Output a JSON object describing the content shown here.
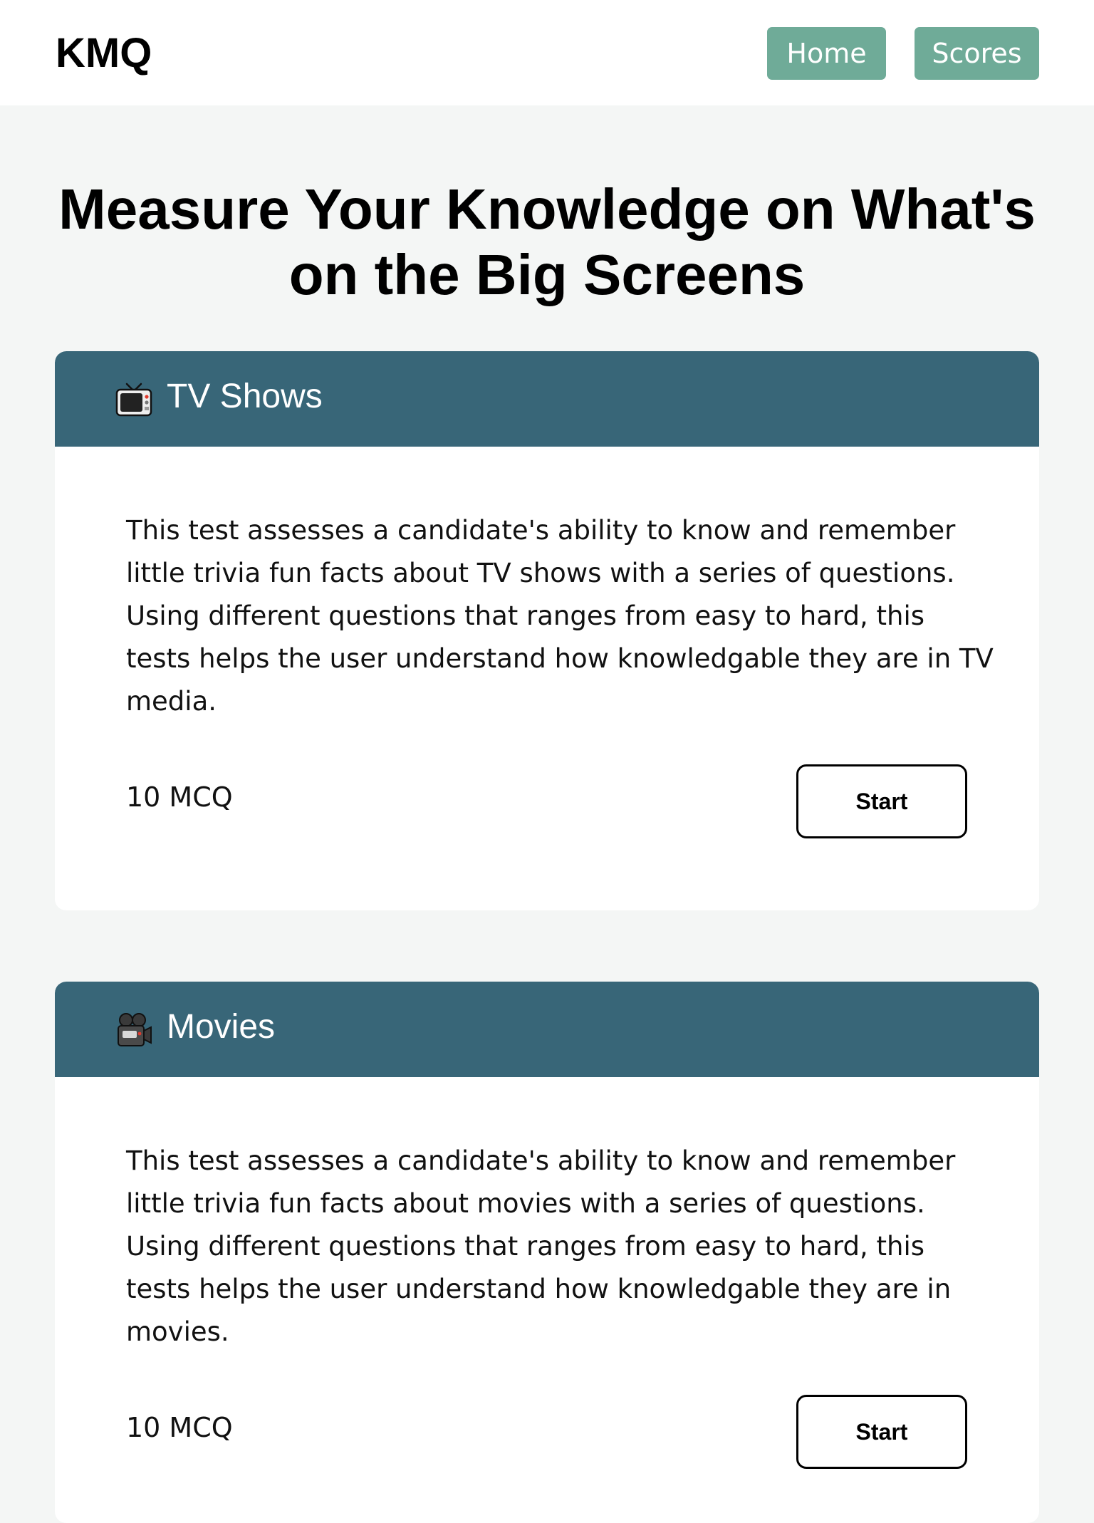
{
  "nav": {
    "logo": "KMQ",
    "links": [
      {
        "label": "Home"
      },
      {
        "label": "Scores"
      }
    ],
    "accent_color": "#6fab98"
  },
  "hero": {
    "title": "Measure Your Knowledge on What's on the Big Screens"
  },
  "header_color": "#386678",
  "quizzes": [
    {
      "icon": "television-icon",
      "title": "TV Shows",
      "description": "This test assesses a candidate's ability to know and remember little trivia fun facts about TV shows with a series of questions. Using different questions that ranges from easy to hard, this tests helps the user understand how knowledgable they are in TV media.",
      "count": "10 MCQ",
      "button_label": "Start"
    },
    {
      "icon": "movie-camera-icon",
      "title": "Movies",
      "description": "This test assesses a candidate's ability to know and remember little trivia fun facts about movies with a series of questions. Using different questions that ranges from easy to hard, this tests helps the user understand how knowledgable they are in movies.",
      "count": "10 MCQ",
      "button_label": "Start"
    }
  ]
}
